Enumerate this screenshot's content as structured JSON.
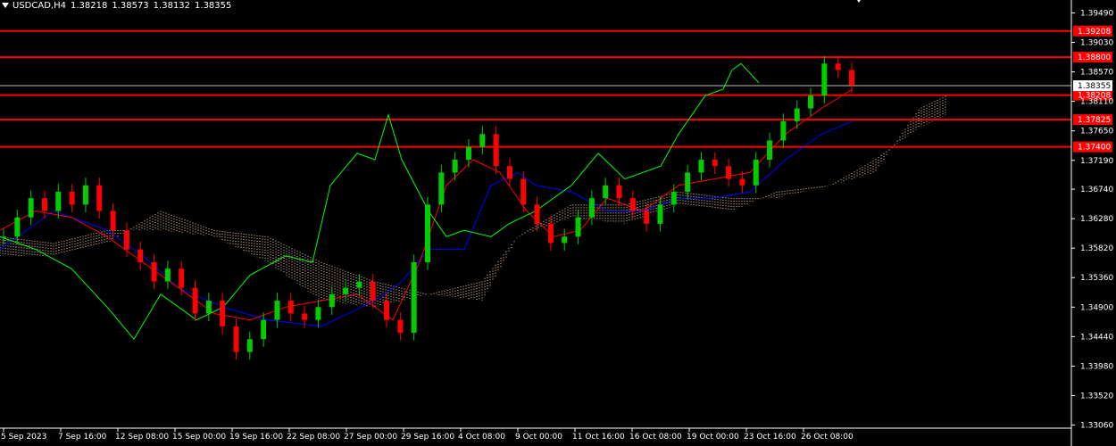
{
  "header": {
    "symbol": "USDCAD,H4",
    "open": "1.38218",
    "high": "1.38573",
    "low": "1.38132",
    "close": "1.38355"
  },
  "colors": {
    "background": "#000000",
    "bull_candle": "#00cc00",
    "bear_candle": "#ff0000",
    "tenkan": "#ff0000",
    "kijun": "#0000ff",
    "chikou": "#00ff00",
    "cloud": "#ffd7b4",
    "level_line": "#ff0000",
    "price_line": "#c0c0c0",
    "axis": "#ffffff"
  },
  "icons": {
    "header_arrow": "triangle-down-icon",
    "window_mark": "triangle-down-icon"
  },
  "chart_data": {
    "type": "candlestick",
    "symbol": "USDCAD",
    "timeframe": "H4",
    "ylim": [
      1.3304,
      1.3962
    ],
    "y_ticks": [
      "1.39490",
      "1.39030",
      "1.38570",
      "1.38110",
      "1.37650",
      "1.37190",
      "1.36740",
      "1.36280",
      "1.35820",
      "1.35360",
      "1.34900",
      "1.34440",
      "1.33980",
      "1.33520",
      "1.33060"
    ],
    "x_ticks": [
      "5 Sep 2023",
      "7 Sep 16:00",
      "12 Sep 08:00",
      "15 Sep 00:00",
      "19 Sep 16:00",
      "22 Sep 08:00",
      "27 Sep 00:00",
      "29 Sep 16:00",
      "4 Oct 08:00",
      "9 Oct 00:00",
      "11 Oct 16:00",
      "16 Oct 08:00",
      "19 Oct 00:00",
      "23 Oct 16:00",
      "26 Oct 08:00"
    ],
    "horizontal_levels": [
      {
        "price": 1.39208,
        "label": "1.39208"
      },
      {
        "price": 1.388,
        "label": "1.38800"
      },
      {
        "price": 1.38208,
        "label": "1.38208"
      },
      {
        "price": 1.37825,
        "label": "1.37825"
      },
      {
        "price": 1.374,
        "label": "1.37400"
      }
    ],
    "current_price": {
      "price": 1.38355,
      "label": "1.38355"
    },
    "candles_approx_close": [
      1.36,
      1.363,
      1.366,
      1.364,
      1.367,
      1.365,
      1.368,
      1.364,
      1.361,
      1.358,
      1.356,
      1.353,
      1.355,
      1.352,
      1.348,
      1.35,
      1.346,
      1.342,
      1.344,
      1.347,
      1.35,
      1.348,
      1.347,
      1.349,
      1.351,
      1.352,
      1.353,
      1.35,
      1.347,
      1.345,
      1.356,
      1.365,
      1.37,
      1.372,
      1.374,
      1.376,
      1.371,
      1.369,
      1.365,
      1.362,
      1.359,
      1.36,
      1.363,
      1.366,
      1.368,
      1.366,
      1.364,
      1.362,
      1.365,
      1.367,
      1.37,
      1.372,
      1.371,
      1.369,
      1.368,
      1.372,
      1.375,
      1.378,
      1.38,
      1.382,
      1.387,
      1.386,
      1.3836
    ]
  }
}
